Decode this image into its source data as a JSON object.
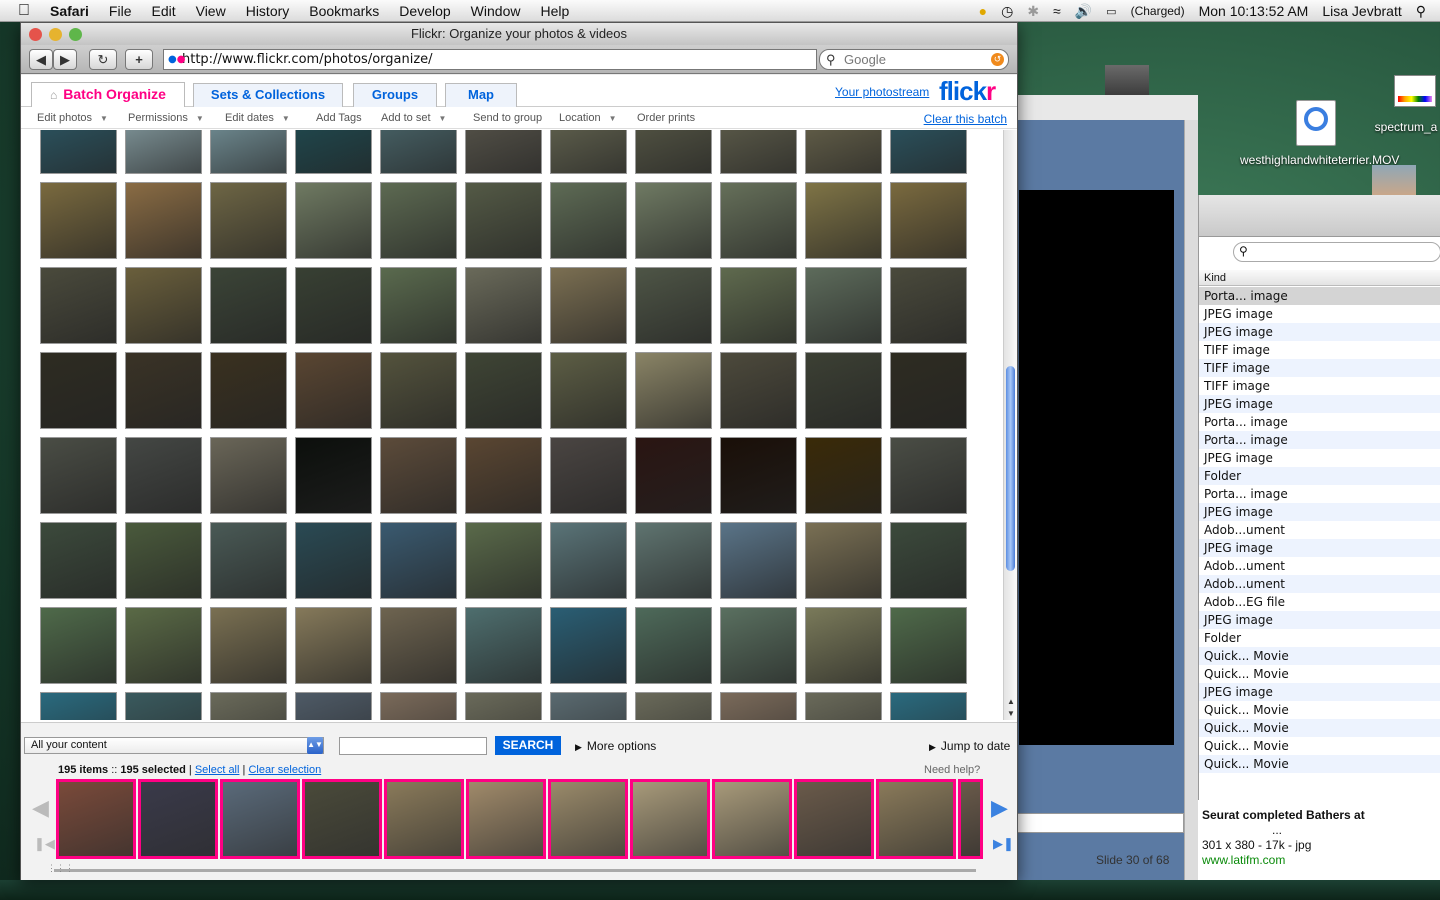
{
  "menubar": {
    "app": "Safari",
    "items": [
      "File",
      "Edit",
      "View",
      "History",
      "Bookmarks",
      "Develop",
      "Window",
      "Help"
    ],
    "battery": "(Charged)",
    "clock": "Mon 10:13:52 AM",
    "user": "Lisa Jevbratt"
  },
  "desktop": {
    "movie_file": "westhighlandwhiteterrier.MOV",
    "spectrum_file": "spectrum_a"
  },
  "window": {
    "title": "Flickr: Organize your photos & videos",
    "url": "http://www.flickr.com/photos/organize/",
    "search_placeholder": "Google"
  },
  "flickr": {
    "tabs": [
      "Batch Organize",
      "Sets & Collections",
      "Groups",
      "Map"
    ],
    "photostream_link": "Your photostream",
    "logo": "flickr",
    "actions": [
      "Edit photos",
      "Permissions",
      "Edit dates",
      "Add Tags",
      "Add to set",
      "Send to group",
      "Location",
      "Order prints"
    ],
    "clear_batch": "Clear this batch",
    "content_filter": "All your content",
    "search_button": "SEARCH",
    "more_options": "More options",
    "jump_to_date": "Jump to date",
    "tray": {
      "count": "195 items",
      "selected": "195 selected",
      "select_all": "Select all",
      "clear_selection": "Clear selection",
      "need_help": "Need help?"
    }
  },
  "finder": {
    "kind_header": "Kind",
    "rows": [
      "Porta... image",
      "JPEG image",
      "JPEG image",
      "TIFF image",
      "TIFF image",
      "TIFF image",
      "JPEG image",
      "Porta... image",
      "Porta... image",
      "JPEG image",
      "Folder",
      "Porta... image",
      "JPEG image",
      "Adob...ument",
      "JPEG image",
      "Adob...ument",
      "Adob...ument",
      "Adob...EG file",
      "JPEG image",
      "Folder",
      "Quick... Movie",
      "Quick... Movie",
      "JPEG image",
      "Quick... Movie",
      "Quick... Movie",
      "Quick... Movie",
      "Quick... Movie"
    ]
  },
  "keynote": {
    "slide_counter": "Slide 30 of 68"
  },
  "image_result": {
    "title": "Seurat completed Bathers at",
    "ellipsis": "...",
    "meta": "301 x 380 - 17k - jpg",
    "url": "www.latifm.com"
  },
  "colors": {
    "flickr_blue": "#0063dc",
    "flickr_pink": "#ff0084"
  },
  "icons": [
    "apple-icon",
    "back-icon",
    "forward-icon",
    "reload-icon",
    "add-bookmark-icon",
    "search-icon",
    "home-icon",
    "chevron-down-icon",
    "chevron-left-icon",
    "chevron-right-icon"
  ]
}
